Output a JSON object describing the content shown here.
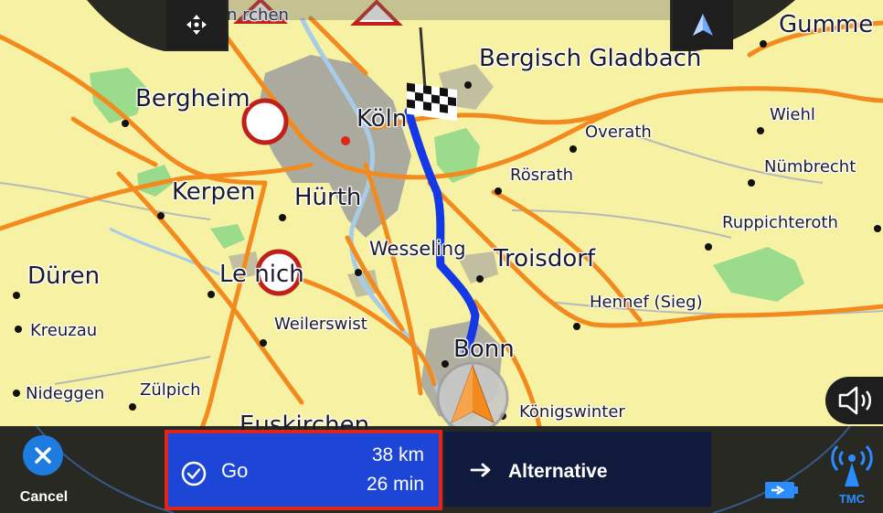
{
  "map": {
    "cities": [
      {
        "id": "gummersbach",
        "label": "Gumme"
      },
      {
        "id": "bergisch-gladbach",
        "label": "Bergisch Gladbach"
      },
      {
        "id": "bergheim",
        "label": "Bergheim"
      },
      {
        "id": "koeln",
        "label": "Köln"
      },
      {
        "id": "wiehl",
        "label": "Wiehl"
      },
      {
        "id": "overath",
        "label": "Overath"
      },
      {
        "id": "roesrath",
        "label": "Rösrath"
      },
      {
        "id": "nuembrecht",
        "label": "Nümbrecht"
      },
      {
        "id": "kerpen",
        "label": "Kerpen"
      },
      {
        "id": "huerth",
        "label": "Hürth"
      },
      {
        "id": "ruppichteroth",
        "label": "Ruppichteroth"
      },
      {
        "id": "wesseling",
        "label": "Wesseling"
      },
      {
        "id": "troisdorf",
        "label": "Troisdorf"
      },
      {
        "id": "dueren",
        "label": "Düren"
      },
      {
        "id": "lechenich",
        "label": "Le     nich"
      },
      {
        "id": "hennef",
        "label": "Hennef (Sieg)"
      },
      {
        "id": "kreuzau",
        "label": "Kreuzau"
      },
      {
        "id": "weilerswist",
        "label": "Weilerswist"
      },
      {
        "id": "bonn",
        "label": "Bonn"
      },
      {
        "id": "nideggen",
        "label": "Nideggen"
      },
      {
        "id": "zuelpich",
        "label": "Zülpich"
      },
      {
        "id": "koenigswinter",
        "label": "Königswinter"
      },
      {
        "id": "euskirchen",
        "label": "Euskirchen"
      },
      {
        "id": "kirchen-top",
        "label": "n    rchen"
      }
    ]
  },
  "toolbar": {
    "move_icon": "move-arrows-icon",
    "compass_icon": "north-arrow-icon",
    "sound_icon": "speaker-icon"
  },
  "bottom": {
    "cancel_label": "Cancel",
    "go_label": "Go",
    "go_distance": "38 km",
    "go_time": "26 min",
    "alternative_label": "Alternative",
    "tmc_label": "TMC"
  },
  "colors": {
    "map_background": "#f7f1a3",
    "route": "#1438e6",
    "go_button": "#1e46d6",
    "go_border": "#e0251b",
    "alternative_button": "#0f1a3d",
    "cancel_button": "#1e7ce0",
    "tmc": "#2a8cff"
  }
}
